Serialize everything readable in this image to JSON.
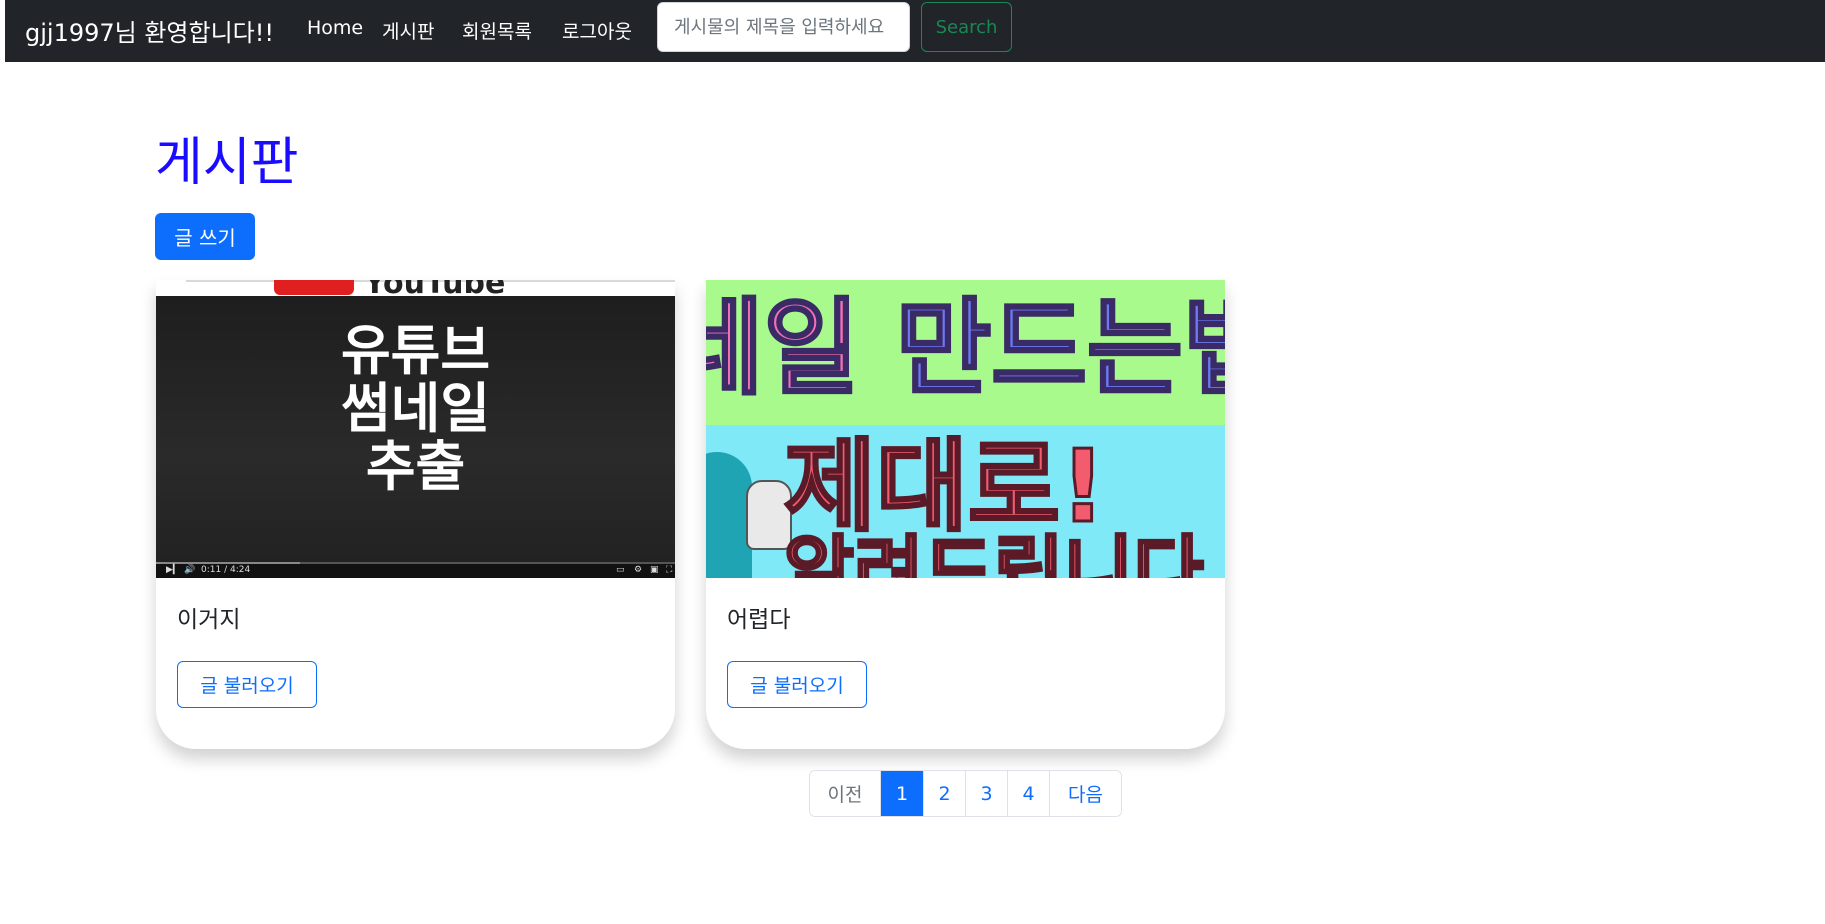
{
  "navbar": {
    "brand": "gjj1997님 환영합니다!!",
    "links": [
      "Home",
      "게시판",
      "회원목록",
      "로그아웃"
    ],
    "search_placeholder": "게시물의 제목을 입력하세요",
    "search_button": "Search"
  },
  "page": {
    "title": "게시판",
    "write_button": "글 쓰기"
  },
  "cards": [
    {
      "title": "이거지",
      "button": "글 불러오기",
      "thumbnail": {
        "logo_text": "YouTube",
        "text": "유튜브\n썸네일\n추출",
        "time": "0:11 / 4:24"
      }
    },
    {
      "title": "어렵다",
      "button": "글 불러오기",
      "thumbnail": {
        "line1_a": "네일",
        "line1_b": "만드는법",
        "line2": "제대로!",
        "line3": "알려드립니다"
      }
    }
  ],
  "pagination": {
    "prev": "이전",
    "pages": [
      "1",
      "2",
      "3",
      "4"
    ],
    "active": "1",
    "next": "다음"
  },
  "colors": {
    "navbar_bg": "#212529",
    "primary": "#0d6efd",
    "success": "#198754",
    "title": "#1a0dff"
  }
}
